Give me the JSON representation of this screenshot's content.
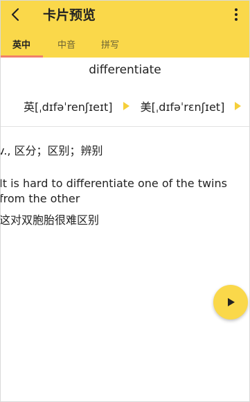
{
  "header": {
    "title": "卡片预览",
    "back_icon": "back-arrow-icon",
    "more_icon": "more-vertical-icon",
    "background": "#fad84a"
  },
  "tabs": [
    {
      "label": "英中",
      "active": true
    },
    {
      "label": "中音",
      "active": false
    },
    {
      "label": "拼写",
      "active": false
    }
  ],
  "card": {
    "word": "differentiate",
    "uk_phonetic": "英[ˌdɪfəˈrenʃɪeɪt]",
    "us_phonetic": "美[ˌdɪfəˈrɛnʃɪet]",
    "meaning": "v., 区分；区别；辨别",
    "example_en": "It is hard to differentiate one of the twins from the other",
    "example_zh": "这对双胞胎很难区别"
  },
  "colors": {
    "accent": "#fad84a",
    "tab_indicator": "#f07f6a",
    "play_small": "#f5cf3a"
  }
}
